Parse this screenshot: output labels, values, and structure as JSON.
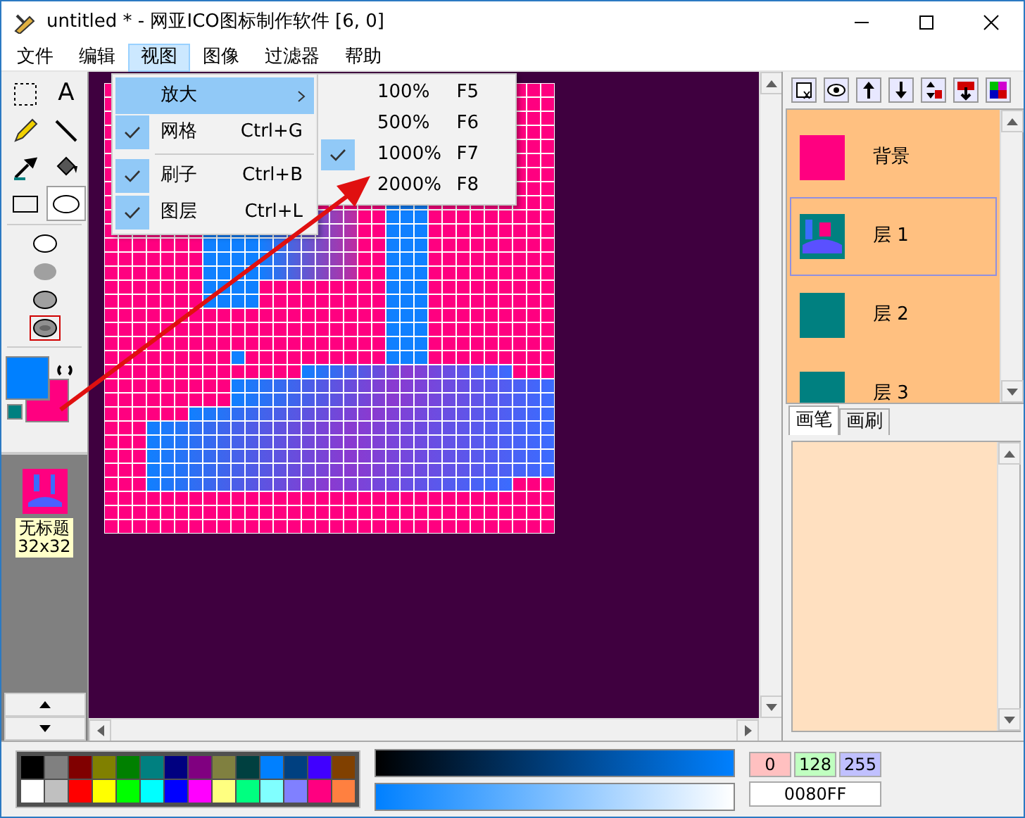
{
  "window": {
    "title": "untitled * - 网亚ICO图标制作软件 [6, 0]"
  },
  "menu": [
    {
      "label": "文件",
      "selected": false
    },
    {
      "label": "编辑",
      "selected": false
    },
    {
      "label": "视图",
      "selected": true
    },
    {
      "label": "图像",
      "selected": false
    },
    {
      "label": "过滤器",
      "selected": false
    },
    {
      "label": "帮助",
      "selected": false
    }
  ],
  "view_menu": [
    {
      "kind": "submenu",
      "label": "放大",
      "highlighted": true
    },
    {
      "kind": "check",
      "label": "网格",
      "shortcut": "Ctrl+G",
      "checked": true
    },
    {
      "kind": "separator"
    },
    {
      "kind": "check",
      "label": "刷子",
      "shortcut": "Ctrl+B",
      "checked": true
    },
    {
      "kind": "check",
      "label": "图层",
      "shortcut": "Ctrl+L",
      "checked": true
    }
  ],
  "zoom_submenu": [
    {
      "label": "100%",
      "shortcut": "F5",
      "checked": false
    },
    {
      "label": "500%",
      "shortcut": "F6",
      "checked": false
    },
    {
      "label": "1000%",
      "shortcut": "F7",
      "checked": true
    },
    {
      "label": "2000%",
      "shortcut": "F8",
      "checked": false
    }
  ],
  "tools": [
    {
      "kind": "select",
      "selected": false
    },
    {
      "kind": "text",
      "label": "A",
      "selected": false
    },
    {
      "kind": "pencil",
      "selected": false
    },
    {
      "kind": "line",
      "selected": false
    },
    {
      "kind": "eyedropper",
      "selected": false
    },
    {
      "kind": "fill",
      "selected": false
    },
    {
      "kind": "rectangle",
      "selected": false
    },
    {
      "kind": "ellipse",
      "selected": true
    }
  ],
  "shape_styles": [
    {
      "kind": "outline",
      "selected": false
    },
    {
      "kind": "fill",
      "selected": false
    },
    {
      "kind": "both",
      "selected": false
    },
    {
      "kind": "shaded",
      "selected": true
    }
  ],
  "color_swatches": [
    {
      "kind": "foreground",
      "color": "#0080ff"
    },
    {
      "kind": "background",
      "color": "#ff0080"
    },
    {
      "kind": "transparent",
      "color": "#008080"
    }
  ],
  "icons": [
    {
      "name": "无标题",
      "size": "32x32"
    }
  ],
  "layers": [
    {
      "name": "背景",
      "kind": "fill",
      "color": "#ff0080",
      "selected": false
    },
    {
      "name": "层 1",
      "kind": "image",
      "selected": true
    },
    {
      "name": "层 2",
      "kind": "fill",
      "color": "#008080",
      "selected": false
    },
    {
      "name": "层 3",
      "kind": "fill",
      "color": "#008080",
      "selected": false
    }
  ],
  "brush_tabs": [
    {
      "label": "画笔",
      "selected": true
    },
    {
      "label": "画刷",
      "selected": false
    }
  ],
  "palette": [
    {
      "color": "#000000"
    },
    {
      "color": "#808080"
    },
    {
      "color": "#800000"
    },
    {
      "color": "#808000"
    },
    {
      "color": "#008000"
    },
    {
      "color": "#008080"
    },
    {
      "color": "#000080"
    },
    {
      "color": "#800080"
    },
    {
      "color": "#808040"
    },
    {
      "color": "#004040"
    },
    {
      "color": "#0080ff"
    },
    {
      "color": "#004080"
    },
    {
      "color": "#4000ff"
    },
    {
      "color": "#804000"
    },
    {
      "color": "#ffffff"
    },
    {
      "color": "#c0c0c0"
    },
    {
      "color": "#ff0000"
    },
    {
      "color": "#ffff00"
    },
    {
      "color": "#00ff00"
    },
    {
      "color": "#00ffff"
    },
    {
      "color": "#0000ff"
    },
    {
      "color": "#ff00ff"
    },
    {
      "color": "#ffff80"
    },
    {
      "color": "#00ff80"
    },
    {
      "color": "#80ffff"
    },
    {
      "color": "#8080ff"
    },
    {
      "color": "#ff0080"
    },
    {
      "color": "#ff8040"
    }
  ],
  "rgb": {
    "r": "0",
    "g": "128",
    "b": "255",
    "hex": "0080FF"
  }
}
